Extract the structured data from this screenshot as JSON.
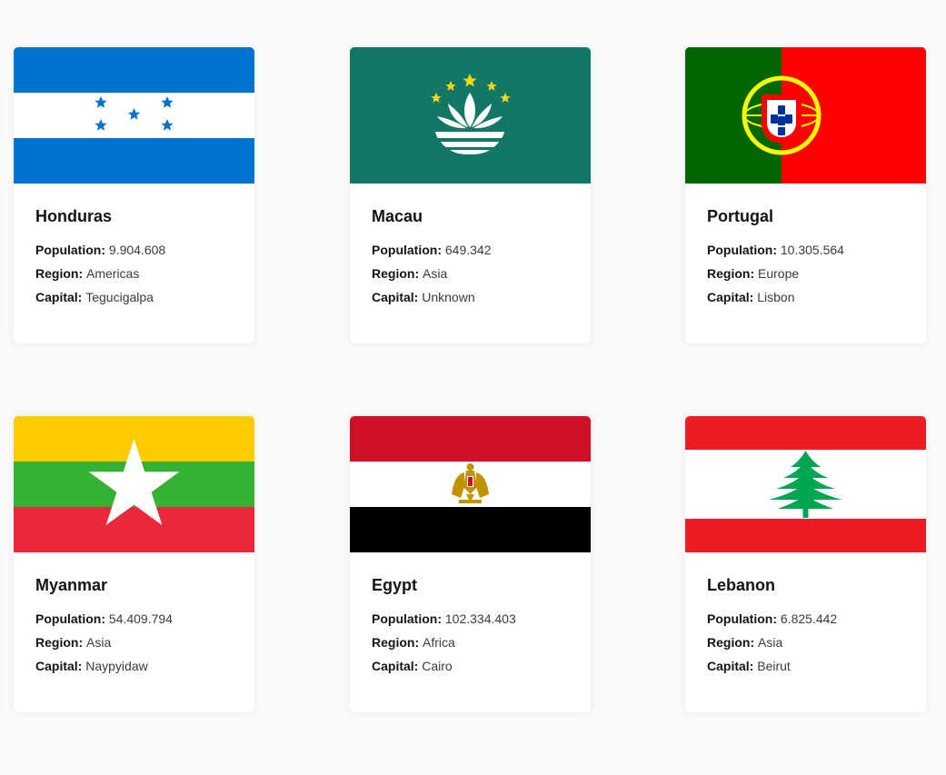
{
  "labels": {
    "population": "Population:",
    "region": "Region:",
    "capital": "Capital:"
  },
  "countries": [
    {
      "name": "Honduras",
      "population": "9.904.608",
      "region": "Americas",
      "capital": "Tegucigalpa",
      "flag_icon": "honduras-flag"
    },
    {
      "name": "Macau",
      "population": "649.342",
      "region": "Asia",
      "capital": "Unknown",
      "flag_icon": "macau-flag"
    },
    {
      "name": "Portugal",
      "population": "10.305.564",
      "region": "Europe",
      "capital": "Lisbon",
      "flag_icon": "portugal-flag"
    },
    {
      "name": "Myanmar",
      "population": "54.409.794",
      "region": "Asia",
      "capital": "Naypyidaw",
      "flag_icon": "myanmar-flag"
    },
    {
      "name": "Egypt",
      "population": "102.334.403",
      "region": "Africa",
      "capital": "Cairo",
      "flag_icon": "egypt-flag"
    },
    {
      "name": "Lebanon",
      "population": "6.825.442",
      "region": "Asia",
      "capital": "Beirut",
      "flag_icon": "lebanon-flag"
    }
  ],
  "colors": {
    "background": "#fafafa",
    "card": "#ffffff",
    "text": "#111517"
  }
}
